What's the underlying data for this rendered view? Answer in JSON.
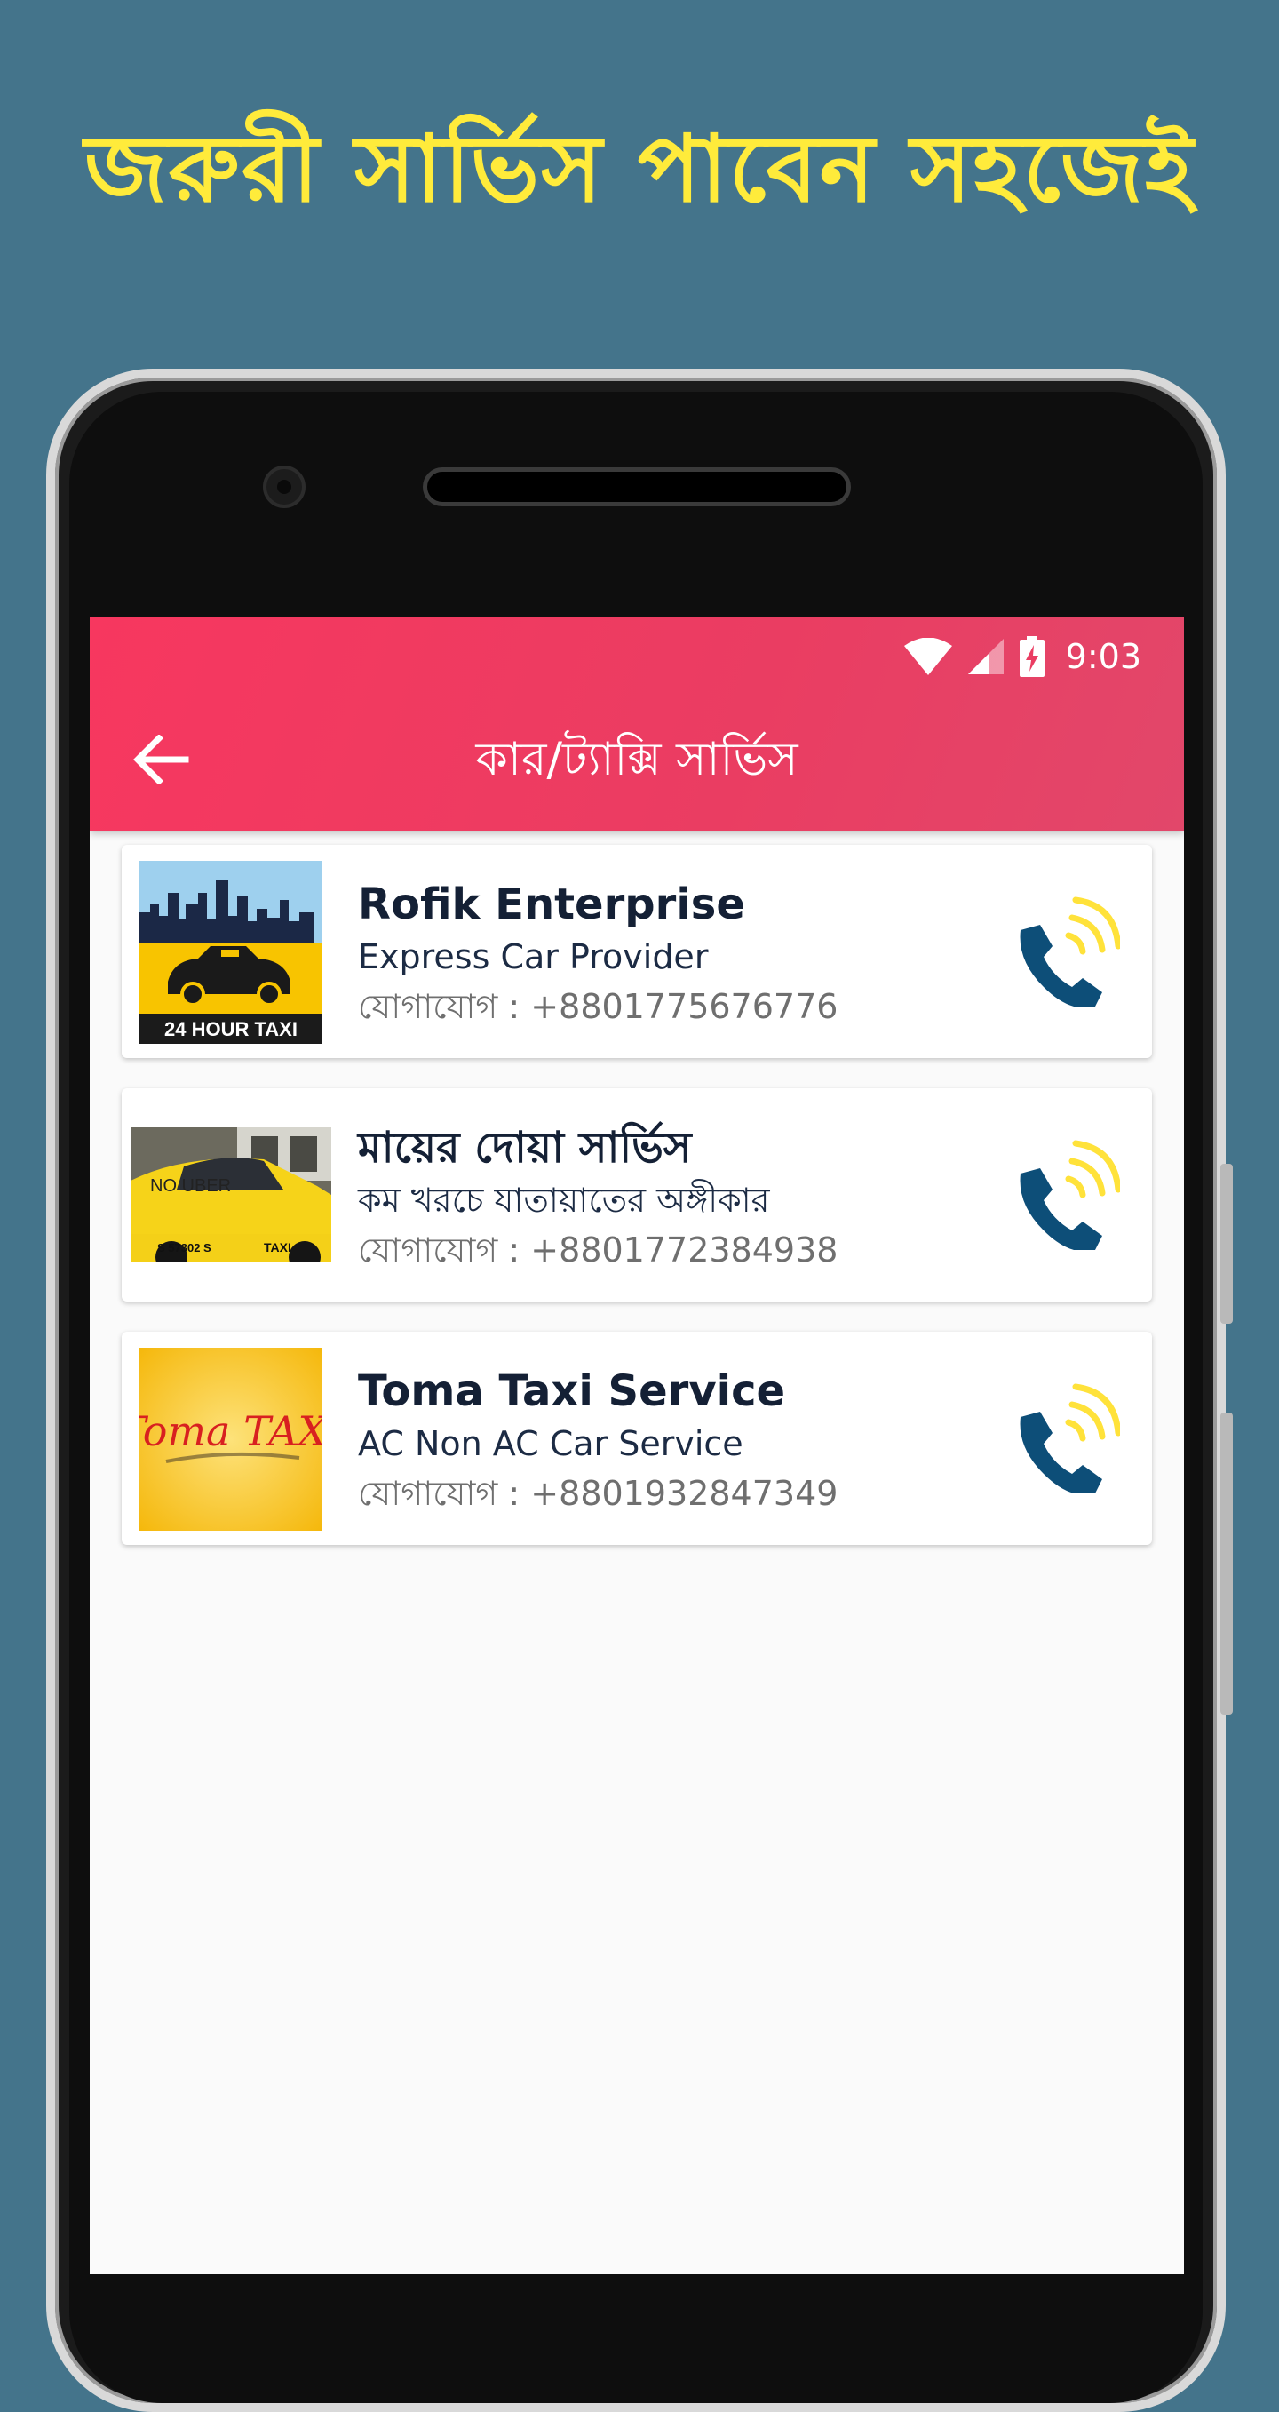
{
  "promo": {
    "headline": "জরুরী সার্ভিস পাবেন সহজেই"
  },
  "status_bar": {
    "time": "9:03",
    "icons": [
      "wifi-icon",
      "cell-signal-icon",
      "battery-charging-icon"
    ]
  },
  "toolbar": {
    "title": "কার/ট্যাক্সি সার্ভিস",
    "back_icon": "arrow-left-icon"
  },
  "colors": {
    "appbar": "#f7375f",
    "headline": "#ffeb3b",
    "background": "#44748b",
    "call_icon_phone": "#0d4e78",
    "call_icon_waves": "#ffe23a"
  },
  "services": [
    {
      "name": "Rofik Enterprise",
      "subtitle": "Express Car Provider",
      "contact": "যোগাযোগ : +8801775676776",
      "thumbnail": "24 HOUR TAXI"
    },
    {
      "name": "মায়ের দোয়া সার্ভিস",
      "subtitle": "কম খরচে যাতায়াতের অঙ্গীকার",
      "contact": "যোগাযোগ : +8801772384938",
      "thumbnail": "NO UBER"
    },
    {
      "name": "Toma Taxi Service",
      "subtitle": "AC Non AC Car Service",
      "contact": "যোগাযোগ : +8801932847349",
      "thumbnail": "Toma TAXI"
    }
  ]
}
